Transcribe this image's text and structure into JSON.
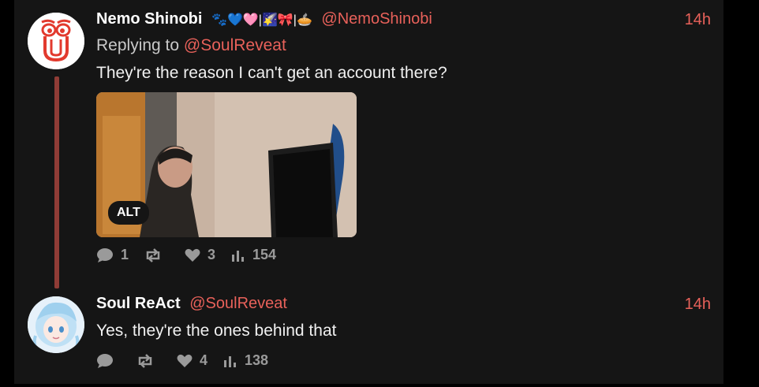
{
  "posts": [
    {
      "display_name": "Nemo Shinobi",
      "name_emojis": "🐾💙🩷|🌠🎀|🥧",
      "handle": "@NemoShinobi",
      "time": "14h",
      "replying_prefix": "Replying to",
      "replying_handle": "@SoulReveat",
      "text": "They're the reason I can't get an account there?",
      "media_alt_badge": "ALT",
      "stats": {
        "replies": "1",
        "reposts": "",
        "likes": "3",
        "views": "154"
      }
    },
    {
      "display_name": "Soul ReAct",
      "handle": "@SoulReveat",
      "time": "14h",
      "text": "Yes, they're the ones behind that",
      "stats": {
        "replies": "",
        "reposts": "",
        "likes": "4",
        "views": "138"
      }
    }
  ],
  "colors": {
    "accent": "#e8615a",
    "thread_line": "#8f3c36",
    "muted": "#9a9a9a",
    "panel_bg": "#151515"
  }
}
